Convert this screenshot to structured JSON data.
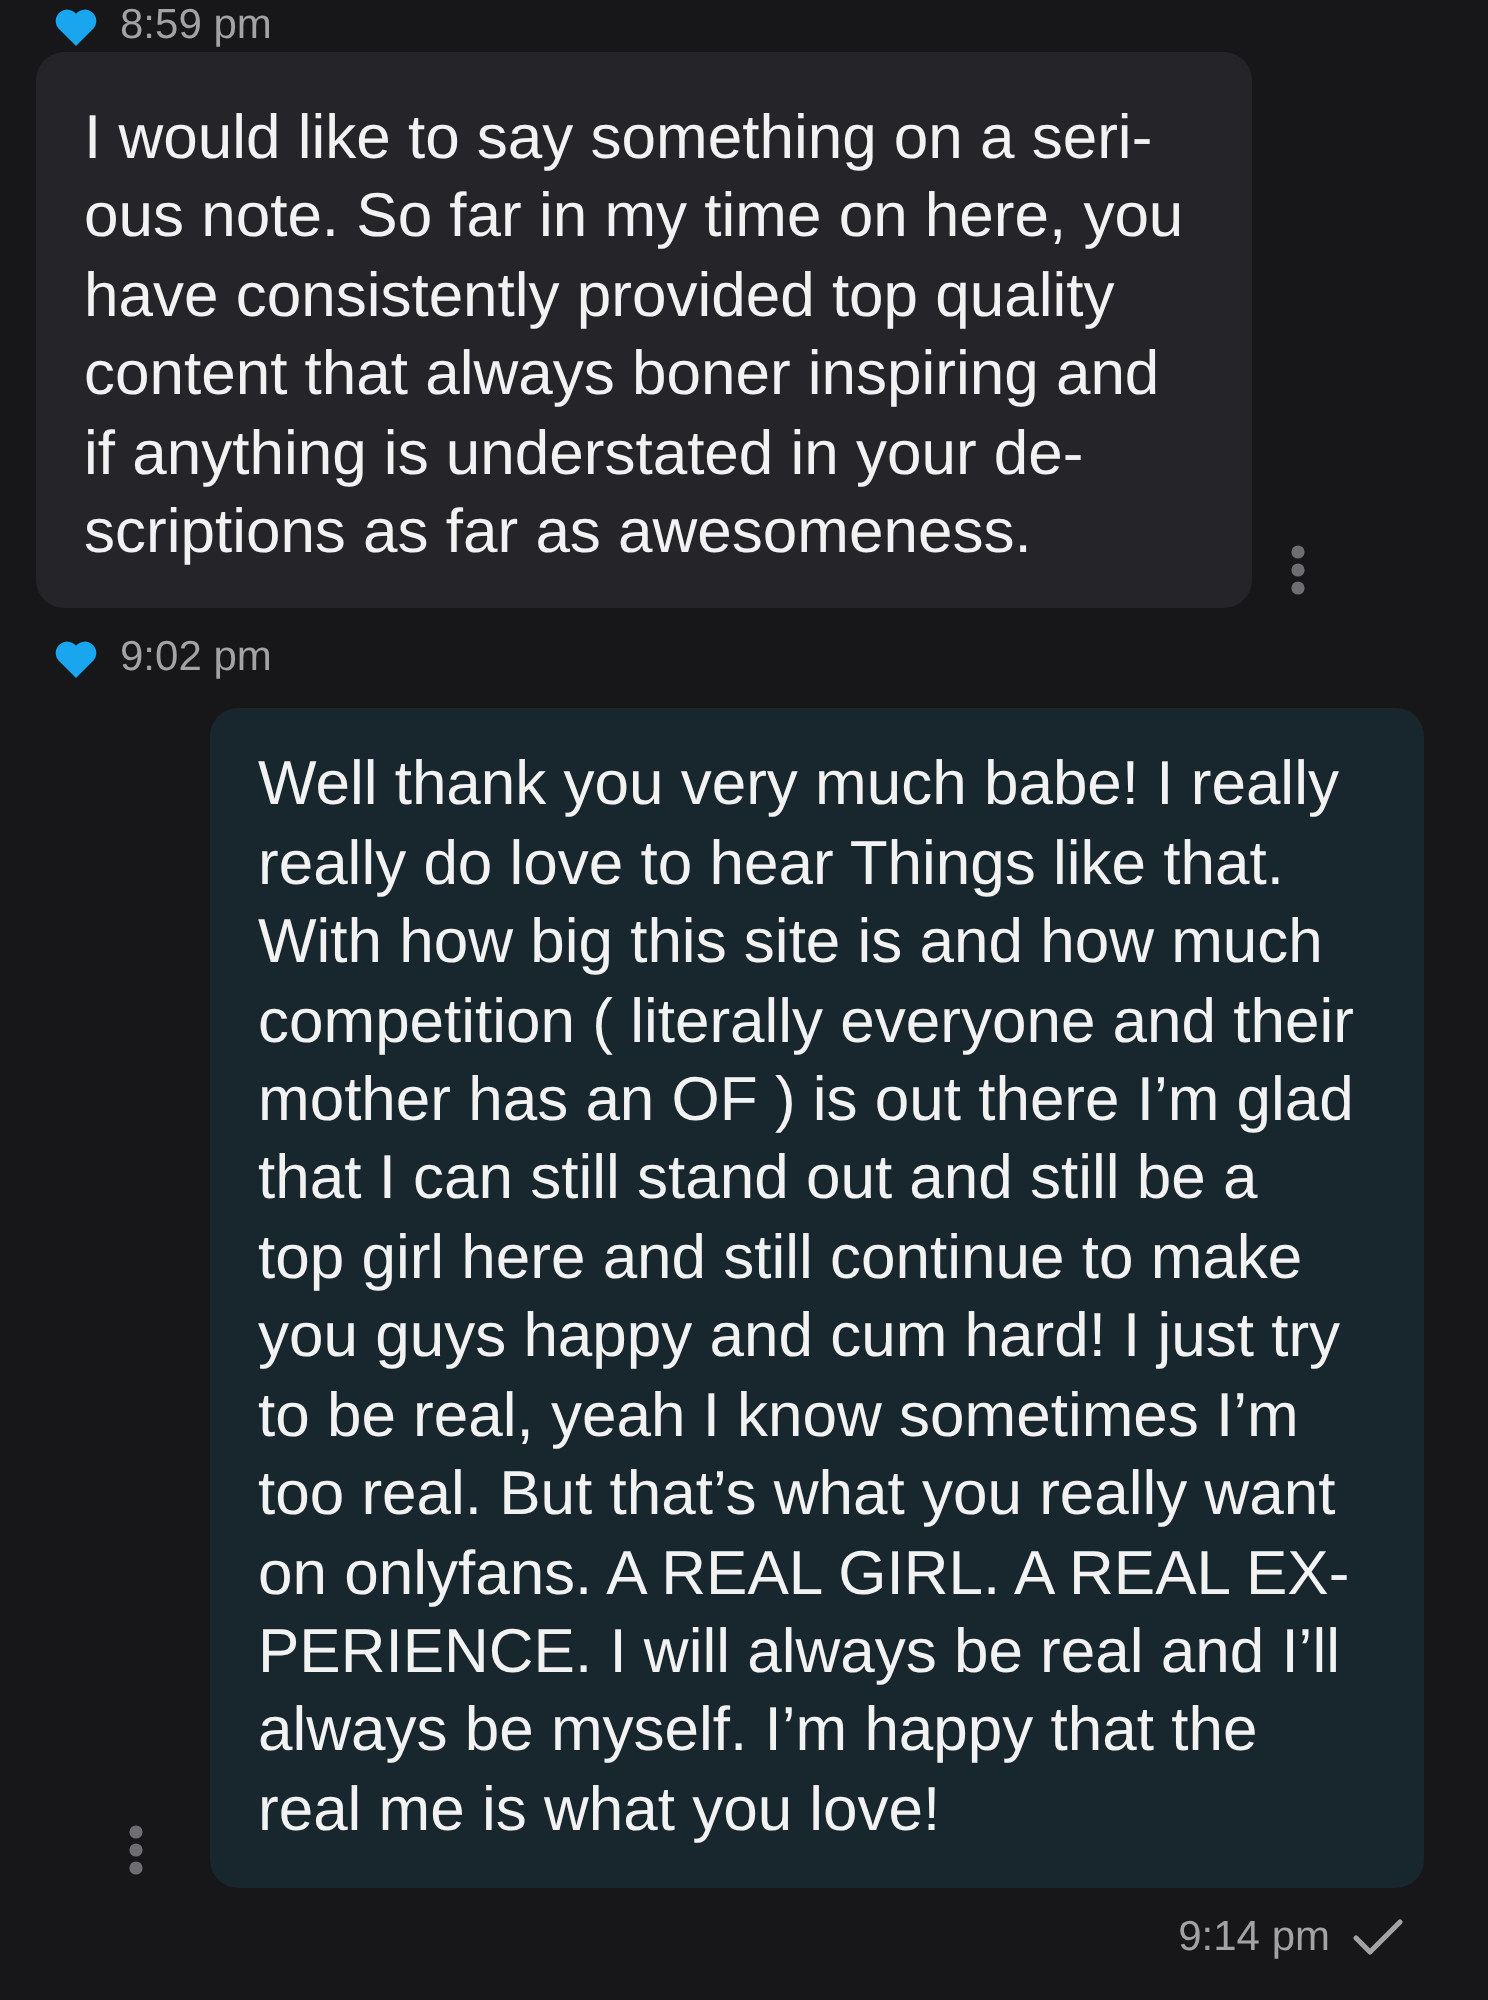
{
  "conversation": [
    {
      "kind": "meta",
      "outgoing": false,
      "liked": true,
      "sent": false,
      "time": "8:59 pm"
    },
    {
      "kind": "message",
      "outgoing": false,
      "lines": [
        "I would like to say something on a seri-",
        "ous note. So far in my time on here, you",
        "have consistently provided top quality",
        "content that always boner inspiring and",
        "if anything is understated in your de-",
        "scriptions as far as awesomeness."
      ]
    },
    {
      "kind": "meta",
      "outgoing": false,
      "liked": true,
      "sent": false,
      "time": "9:02 pm"
    },
    {
      "kind": "message",
      "outgoing": true,
      "lines": [
        "Well thank you very much babe! I really",
        "really do love to hear Things like that.",
        "With how big this site is and how much",
        "competition ( literally everyone and their",
        "mother has an OF ) is out there I’m glad",
        "that I can still stand out and still be a",
        "top girl here and still continue to make",
        "you guys happy and cum hard! I just try",
        "to be real, yeah I know sometimes I’m",
        "too real. But that’s what you really want",
        "on onlyfans. A REAL GIRL. A REAL EX-",
        "PERIENCE. I will always be real and I’ll",
        "always be myself. I’m happy that the",
        "real me is what you love!"
      ]
    },
    {
      "kind": "meta",
      "outgoing": true,
      "liked": false,
      "sent": true,
      "time": "9:14 pm"
    }
  ]
}
